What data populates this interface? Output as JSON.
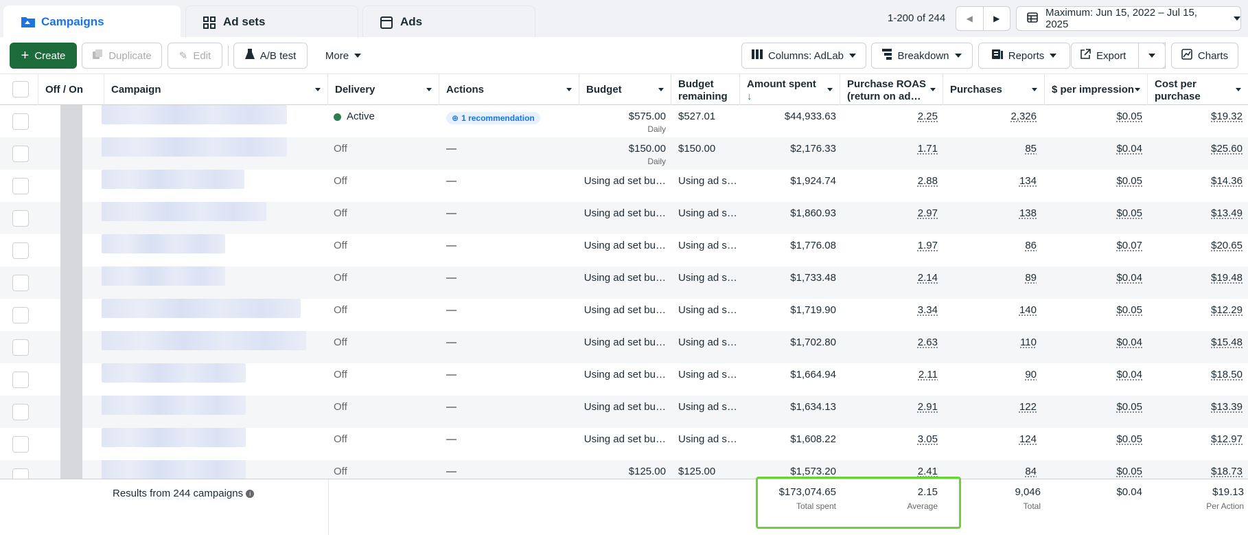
{
  "tabs": [
    {
      "label": "Campaigns",
      "active": true,
      "icon": "folder-icon"
    },
    {
      "label": "Ad sets",
      "active": false,
      "icon": "grid-icon"
    },
    {
      "label": "Ads",
      "active": false,
      "icon": "ad-icon"
    }
  ],
  "pagination": {
    "range_text": "1-200 of 244"
  },
  "date_range": {
    "label": "Maximum: Jun 15, 2022 – Jul 15, 2025"
  },
  "toolbar": {
    "create": "Create",
    "duplicate": "Duplicate",
    "edit": "Edit",
    "ab_test": "A/B test",
    "more": "More",
    "columns": "Columns: AdLab",
    "breakdown": "Breakdown",
    "reports": "Reports",
    "export": "Export",
    "charts": "Charts"
  },
  "columns": {
    "off_on": "Off / On",
    "campaign": "Campaign",
    "delivery": "Delivery",
    "actions": "Actions",
    "budget": "Budget",
    "budget_remaining_1": "Budget",
    "budget_remaining_2": "remaining",
    "amount_spent": "Amount spent",
    "amount_spent_sort": "↓",
    "roas_1": "Purchase ROAS",
    "roas_2": "(return on ad…",
    "purchases": "Purchases",
    "per_impression": "$ per impression",
    "cost_per_purchase_1": "Cost per",
    "cost_per_purchase_2": "purchase"
  },
  "rows": [
    {
      "delivery": "Active",
      "delivery_active": true,
      "action": "1 recommendation",
      "budget": "$575.00",
      "budget_sub": "Daily",
      "remaining": "$527.01",
      "spent": "$44,933.63",
      "roas": "2.25",
      "purchases": "2,326",
      "per_impression": "$0.05",
      "cost_per_purchase": "$19.32"
    },
    {
      "delivery": "Off",
      "action": "—",
      "budget": "$150.00",
      "budget_sub": "Daily",
      "remaining": "$150.00",
      "spent": "$2,176.33",
      "roas": "1.71",
      "purchases": "85",
      "per_impression": "$0.04",
      "cost_per_purchase": "$25.60"
    },
    {
      "delivery": "Off",
      "action": "—",
      "budget": "Using ad set bu…",
      "remaining": "Using ad s…",
      "spent": "$1,924.74",
      "roas": "2.88",
      "purchases": "134",
      "per_impression": "$0.05",
      "cost_per_purchase": "$14.36"
    },
    {
      "delivery": "Off",
      "action": "—",
      "budget": "Using ad set bu…",
      "remaining": "Using ad s…",
      "spent": "$1,860.93",
      "roas": "2.97",
      "purchases": "138",
      "per_impression": "$0.05",
      "cost_per_purchase": "$13.49"
    },
    {
      "delivery": "Off",
      "action": "—",
      "budget": "Using ad set bu…",
      "remaining": "Using ad s…",
      "spent": "$1,776.08",
      "roas": "1.97",
      "purchases": "86",
      "per_impression": "$0.07",
      "cost_per_purchase": "$20.65"
    },
    {
      "delivery": "Off",
      "action": "—",
      "budget": "Using ad set bu…",
      "remaining": "Using ad s…",
      "spent": "$1,733.48",
      "roas": "2.14",
      "purchases": "89",
      "per_impression": "$0.04",
      "cost_per_purchase": "$19.48"
    },
    {
      "delivery": "Off",
      "action": "—",
      "budget": "Using ad set bu…",
      "remaining": "Using ad s…",
      "spent": "$1,719.90",
      "roas": "3.34",
      "purchases": "140",
      "per_impression": "$0.05",
      "cost_per_purchase": "$12.29"
    },
    {
      "delivery": "Off",
      "action": "—",
      "budget": "Using ad set bu…",
      "remaining": "Using ad s…",
      "spent": "$1,702.80",
      "roas": "2.63",
      "purchases": "110",
      "per_impression": "$0.04",
      "cost_per_purchase": "$15.48"
    },
    {
      "delivery": "Off",
      "action": "—",
      "budget": "Using ad set bu…",
      "remaining": "Using ad s…",
      "spent": "$1,664.94",
      "roas": "2.11",
      "purchases": "90",
      "per_impression": "$0.04",
      "cost_per_purchase": "$18.50"
    },
    {
      "delivery": "Off",
      "action": "—",
      "budget": "Using ad set bu…",
      "remaining": "Using ad s…",
      "spent": "$1,634.13",
      "roas": "2.91",
      "purchases": "122",
      "per_impression": "$0.05",
      "cost_per_purchase": "$13.39"
    },
    {
      "delivery": "Off",
      "action": "—",
      "budget": "Using ad set bu…",
      "remaining": "Using ad s…",
      "spent": "$1,608.22",
      "roas": "3.05",
      "purchases": "124",
      "per_impression": "$0.05",
      "cost_per_purchase": "$12.97"
    },
    {
      "delivery": "Off",
      "action": "—",
      "budget": "$125.00",
      "remaining": "$125.00",
      "spent": "$1,573.20",
      "roas": "2.41",
      "purchases": "84",
      "per_impression": "$0.05",
      "cost_per_purchase": "$18.73"
    }
  ],
  "footer": {
    "results": "Results from 244 campaigns",
    "total_spent": "$173,074.65",
    "total_spent_label": "Total spent",
    "roas": "2.15",
    "roas_label": "Average",
    "purchases": "9,046",
    "purchases_label": "Total",
    "per_impression": "$0.04",
    "cost_per_purchase": "$19.13",
    "cost_per_purchase_label": "Per Action"
  },
  "colors": {
    "accent": "#1b74e4",
    "create_button": "#1d6b3a",
    "highlight": "#6cd13a"
  }
}
